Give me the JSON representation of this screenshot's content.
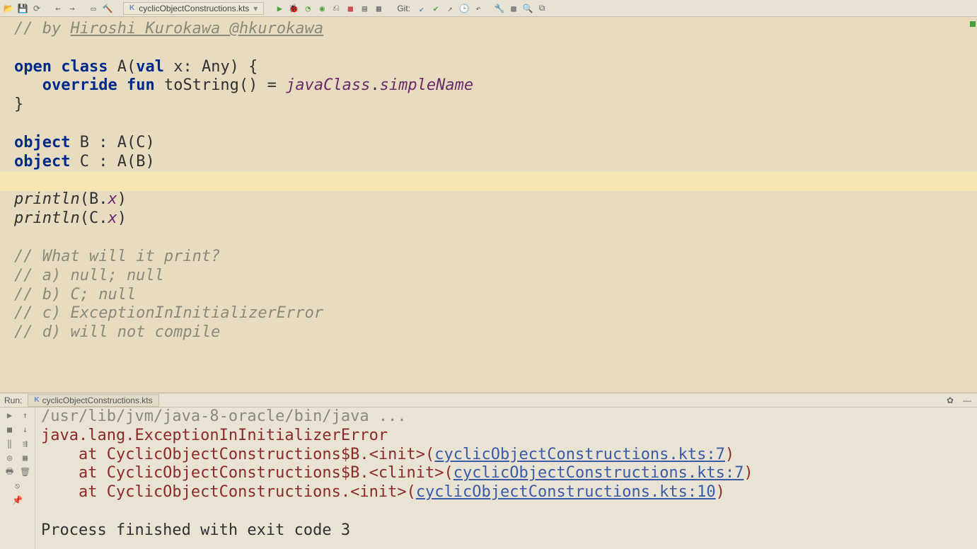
{
  "toolbar": {
    "file_tab": "cyclicObjectConstructions.kts",
    "git_label": "Git:"
  },
  "code": {
    "l1_comment_prefix": "// by ",
    "l1_author": "Hiroshi Kurokawa @hkurokawa",
    "l3_open": "open",
    "l3_class": "class",
    "l3_name": " A(",
    "l3_val": "val",
    "l3_x": " x: Any) {",
    "l4_indent": "   ",
    "l4_override": "override",
    "l4_fun": "fun",
    "l4_ts": " toString() = ",
    "l4_jc": "javaClass",
    "l4_dot": ".",
    "l4_sn": "simpleName",
    "l5_close": "}",
    "l7_object": "object",
    "l7_b": " B : A(C)",
    "l8_object": "object",
    "l8_c": " C : A(B)",
    "l10_println": "println",
    "l10_arg": "(B.",
    "l10_x": "x",
    "l10_close": ")",
    "l11_println": "println",
    "l11_arg": "(C.",
    "l11_x": "x",
    "l11_close": ")",
    "l13": "// What will it print?",
    "l14": "// a) null; null",
    "l15": "// b) C; null",
    "l16": "// c) ExceptionInInitializerError",
    "l17": "// d) will not compile"
  },
  "run": {
    "label": "Run:",
    "tab": "cyclicObjectConstructions.kts",
    "out0": "/usr/lib/jvm/java-8-oracle/bin/java ...",
    "err1": "java.lang.ExceptionInInitializerError",
    "err2a": "    at CyclicObjectConstructions$B.<init>(",
    "err2l": "cyclicObjectConstructions.kts:7",
    "err2b": ")",
    "err3a": "    at CyclicObjectConstructions$B.<clinit>(",
    "err3l": "cyclicObjectConstructions.kts:7",
    "err3b": ")",
    "err4a": "    at CyclicObjectConstructions.<init>(",
    "err4l": "cyclicObjectConstructions.kts:10",
    "err4b": ")",
    "exit": "Process finished with exit code 3"
  }
}
